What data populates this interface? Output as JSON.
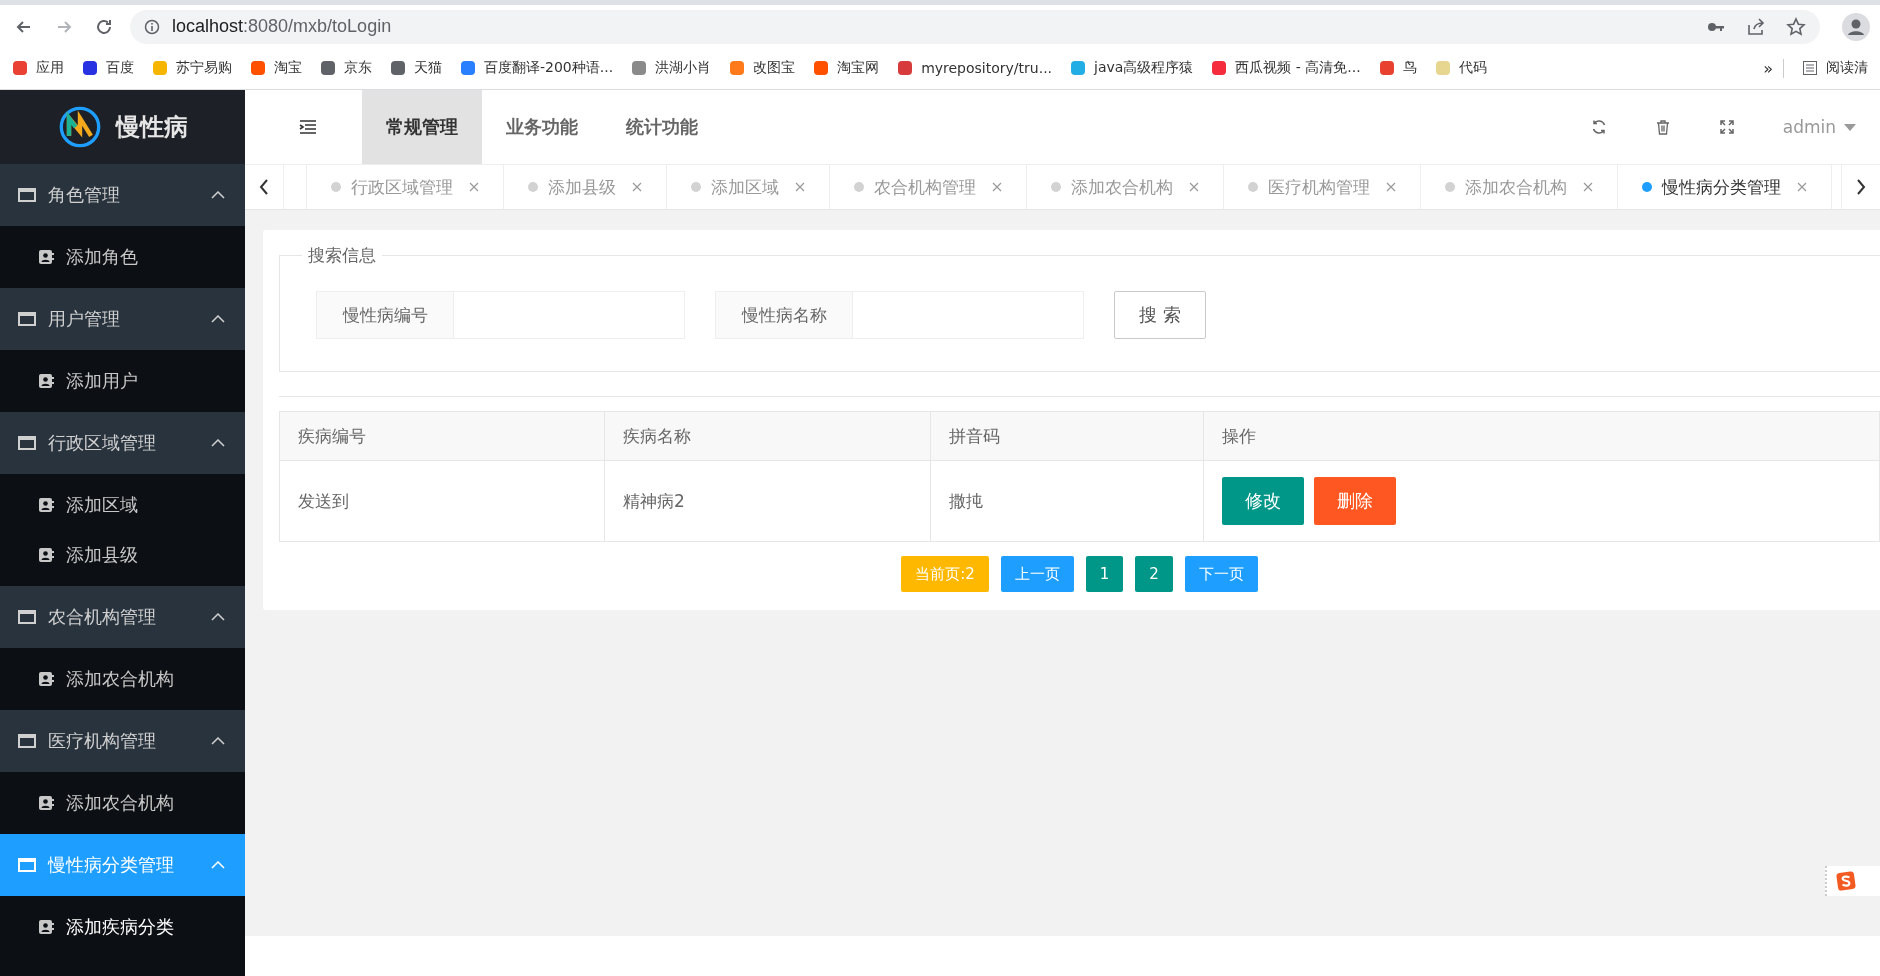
{
  "browser": {
    "url_host": "localhost",
    "url_rest": ":8080/mxb/toLogin",
    "bookmarks": [
      {
        "label": "应用",
        "color": "#e94235"
      },
      {
        "label": "百度",
        "color": "#2932e1"
      },
      {
        "label": "苏宁易购",
        "color": "#f6b500"
      },
      {
        "label": "淘宝",
        "color": "#ff5000"
      },
      {
        "label": "京东",
        "color": "#5f6368"
      },
      {
        "label": "天猫",
        "color": "#5f6368"
      },
      {
        "label": "百度翻译-200种语...",
        "color": "#2a7fff"
      },
      {
        "label": "洪湖小肖",
        "color": "#8a8a8a"
      },
      {
        "label": "改图宝",
        "color": "#ff7a1a"
      },
      {
        "label": "淘宝网",
        "color": "#ff5000"
      },
      {
        "label": "myrepository/tru...",
        "color": "#d83b3b"
      },
      {
        "label": "java高级程序猿",
        "color": "#23ade5"
      },
      {
        "label": "西瓜视频 - 高清免...",
        "color": "#f42c3b"
      },
      {
        "label": "鸟",
        "color": "#e8412f"
      },
      {
        "label": "代码",
        "color": "#e6d690"
      }
    ],
    "more": "»",
    "reading_list": "阅读清"
  },
  "sidebar": {
    "logo": "慢性病",
    "groups": [
      {
        "label": "角色管理",
        "expanded": true,
        "selected": false,
        "children": [
          {
            "label": "添加角色"
          }
        ]
      },
      {
        "label": "用户管理",
        "expanded": true,
        "selected": false,
        "children": [
          {
            "label": "添加用户"
          }
        ]
      },
      {
        "label": "行政区域管理",
        "expanded": true,
        "selected": false,
        "children": [
          {
            "label": "添加区域"
          },
          {
            "label": "添加县级"
          }
        ]
      },
      {
        "label": "农合机构管理",
        "expanded": true,
        "selected": false,
        "children": [
          {
            "label": "添加农合机构"
          }
        ]
      },
      {
        "label": "医疗机构管理",
        "expanded": true,
        "selected": false,
        "children": [
          {
            "label": "添加农合机构"
          }
        ]
      },
      {
        "label": "慢性病分类管理",
        "expanded": true,
        "selected": true,
        "children": [
          {
            "label": "添加疾病分类"
          }
        ]
      }
    ]
  },
  "header": {
    "nav": [
      {
        "label": "常规管理",
        "selected": true
      },
      {
        "label": "业务功能",
        "selected": false
      },
      {
        "label": "统计功能",
        "selected": false
      }
    ],
    "user": "admin"
  },
  "tabs": [
    {
      "label": "行政区域管理",
      "selected": false
    },
    {
      "label": "添加县级",
      "selected": false
    },
    {
      "label": "添加区域",
      "selected": false
    },
    {
      "label": "农合机构管理",
      "selected": false
    },
    {
      "label": "添加农合机构",
      "selected": false
    },
    {
      "label": "医疗机构管理",
      "selected": false
    },
    {
      "label": "添加农合机构",
      "selected": false
    },
    {
      "label": "慢性病分类管理",
      "selected": true
    }
  ],
  "search": {
    "legend": "搜索信息",
    "fields": [
      {
        "label": "慢性病编号"
      },
      {
        "label": "慢性病名称"
      }
    ],
    "button": "搜 索"
  },
  "table": {
    "columns": [
      "疾病编号",
      "疾病名称",
      "拼音码",
      "操作"
    ],
    "rows": [
      {
        "cells": [
          "发送到",
          "精神病2",
          "撒扽"
        ],
        "actions": [
          {
            "label": "修改",
            "kind": "edit"
          },
          {
            "label": "删除",
            "kind": "delete"
          }
        ]
      }
    ]
  },
  "pagination": [
    {
      "label": "当前页:2",
      "kind": "current"
    },
    {
      "label": "上一页",
      "kind": "nav"
    },
    {
      "label": "1",
      "kind": "page"
    },
    {
      "label": "2",
      "kind": "page"
    },
    {
      "label": "下一页",
      "kind": "nav"
    }
  ]
}
